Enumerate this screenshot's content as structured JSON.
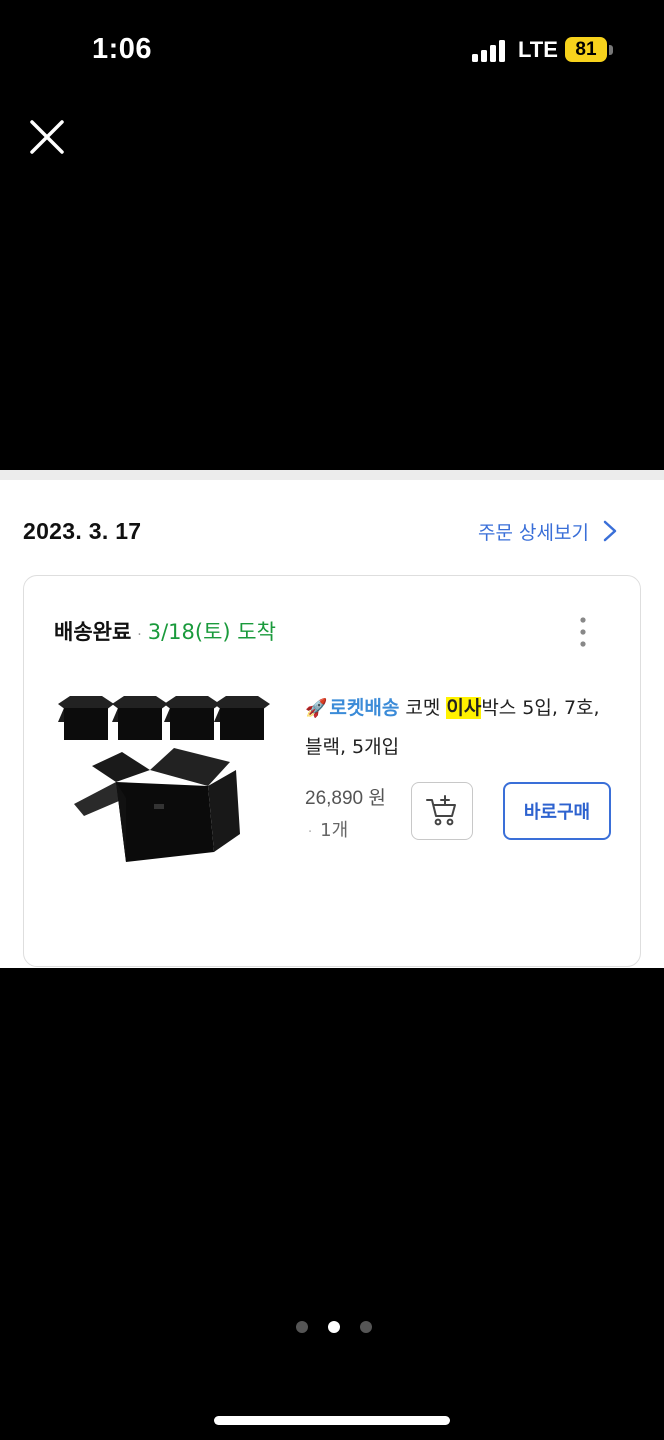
{
  "status_bar": {
    "time": "1:06",
    "network": "LTE",
    "battery": "81",
    "battery_color": "#f7d21c"
  },
  "order": {
    "date": "2023. 3. 17",
    "detail_link": "주문 상세보기",
    "status_label": "배송완료",
    "status_dot": "·",
    "arrival": "3/18(토) 도착",
    "arrival_color": "#1a9a3c",
    "product": {
      "rocket_badge": "로켓배송",
      "rocket_icon": "rocket-icon",
      "title_before": "코멧 ",
      "title_highlight": "이사",
      "title_after": "박스 5입, 7호, 블랙, 5개입",
      "price": "26,890 원",
      "quantity_dot": "·",
      "quantity": "1개",
      "cart_icon": "add-to-cart-icon",
      "buy_now_label": "바로구매"
    }
  },
  "pager": {
    "count": 3,
    "active_index": 1
  },
  "colors": {
    "accent": "#3a6fd8",
    "highlight": "#fff200"
  }
}
